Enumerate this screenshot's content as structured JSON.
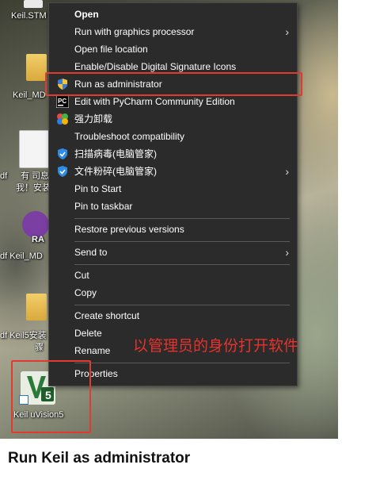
{
  "desktop": {
    "icons": [
      {
        "label": "Keil.STM"
      },
      {
        "label": "Keil_MD"
      },
      {
        "label": "df"
      },
      {
        "label": "有 司息"
      },
      {
        "label": "我！安装"
      },
      {
        "label": "RA"
      },
      {
        "label": "df  Keil_MD"
      },
      {
        "label": "df  Keil5安装"
      },
      {
        "label": "骤"
      },
      {
        "label": "Keil uVision5"
      }
    ],
    "keil_badge": "5"
  },
  "context_menu": {
    "items": [
      {
        "label": "Open",
        "bold": true
      },
      {
        "label": "Run with graphics processor",
        "submenu": true
      },
      {
        "label": "Open file location"
      },
      {
        "label": "Enable/Disable Digital Signature Icons"
      },
      {
        "label": "Run as administrator",
        "icon": "shield-icon"
      },
      {
        "label": "Edit with PyCharm Community Edition",
        "icon": "pycharm-icon"
      },
      {
        "label": "强力卸载",
        "icon": "uninstall-icon"
      },
      {
        "label": "Troubleshoot compatibility"
      },
      {
        "label": "扫描病毒(电脑管家)",
        "icon": "tencent-shield-icon"
      },
      {
        "label": "文件粉碎(电脑管家)",
        "icon": "tencent-shield-icon",
        "submenu": true
      },
      {
        "label": "Pin to Start"
      },
      {
        "label": "Pin to taskbar"
      },
      {
        "label": "Restore previous versions"
      },
      {
        "label": "Send to",
        "submenu": true
      },
      {
        "label": "Cut"
      },
      {
        "label": "Copy"
      },
      {
        "label": "Create shortcut"
      },
      {
        "label": "Delete"
      },
      {
        "label": "Rename"
      },
      {
        "label": "Properties"
      }
    ],
    "submenu_arrow": "›"
  },
  "annotation": "以管理员的身份打开软件",
  "caption": "Run Keil as administrator",
  "colors": {
    "menu_bg": "#2b2b2b",
    "highlight": "#e03b2f",
    "annotation": "#e8322d"
  }
}
